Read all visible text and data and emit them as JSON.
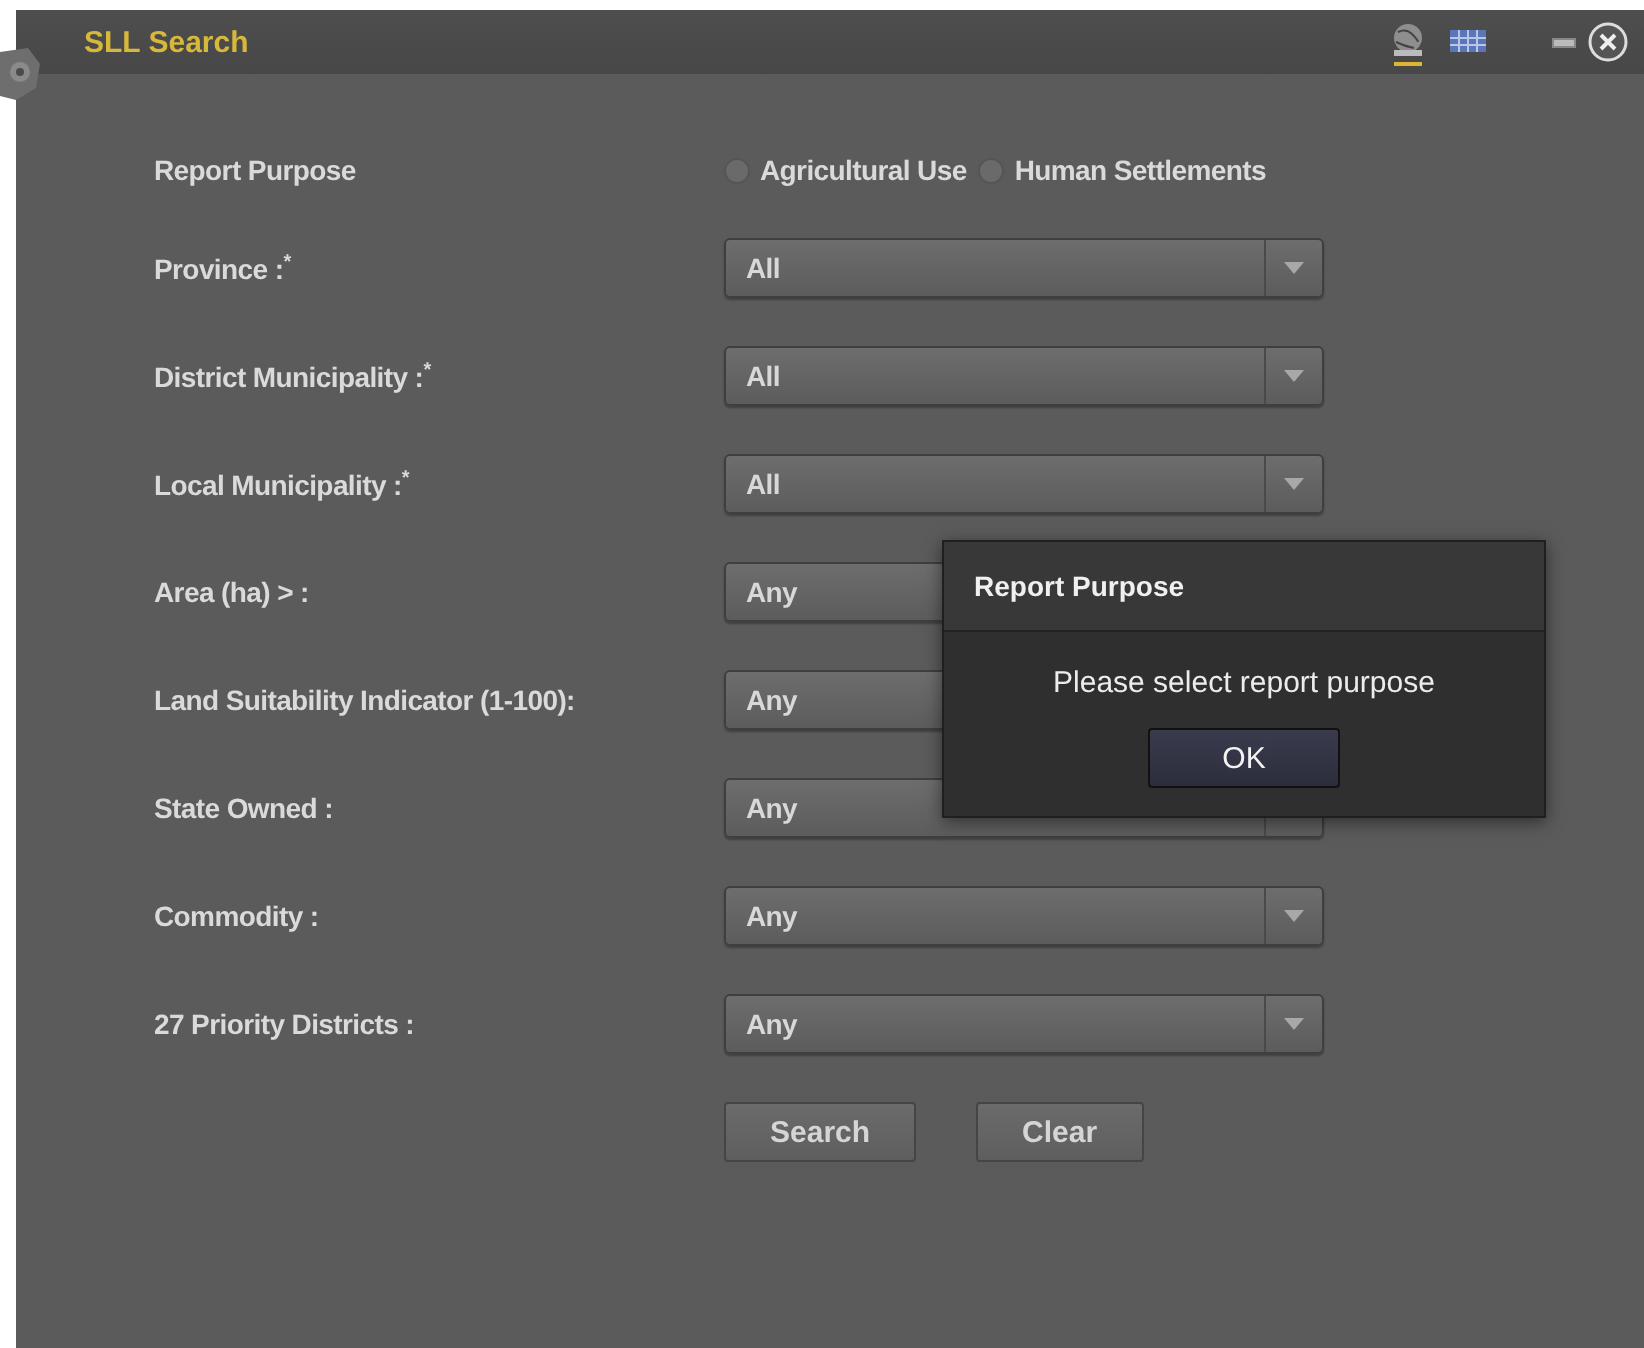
{
  "window": {
    "title": "SLL Search"
  },
  "toolbar": [
    {
      "kind": "map",
      "selected": true
    },
    {
      "kind": "table",
      "selected": false
    }
  ],
  "report_purpose": {
    "label": "Report Purpose",
    "options": [
      {
        "label": "Agricultural Use",
        "selected": false
      },
      {
        "label": "Human Settlements",
        "selected": false
      }
    ]
  },
  "fields": [
    {
      "label": "Province :$^{*}$",
      "value": "All"
    },
    {
      "label": "District Municipality :$^{*}$",
      "value": "All"
    },
    {
      "label": "Local Municipality :$^{*}$",
      "value": "All"
    },
    {
      "label": "Area (ha) > :",
      "value": "Any"
    },
    {
      "label": "Land Suitability Indicator (1-100):",
      "value": "Any"
    },
    {
      "label": "State Owned :",
      "value": "Any"
    },
    {
      "label": "Commodity :",
      "value": "Any"
    },
    {
      "label": "27 Priority Districts :",
      "value": "Any"
    }
  ],
  "buttons": [
    "Search",
    "Clear"
  ],
  "dialog": {
    "title": "Report Purpose",
    "message": "Please select report purpose",
    "button": "OK"
  }
}
